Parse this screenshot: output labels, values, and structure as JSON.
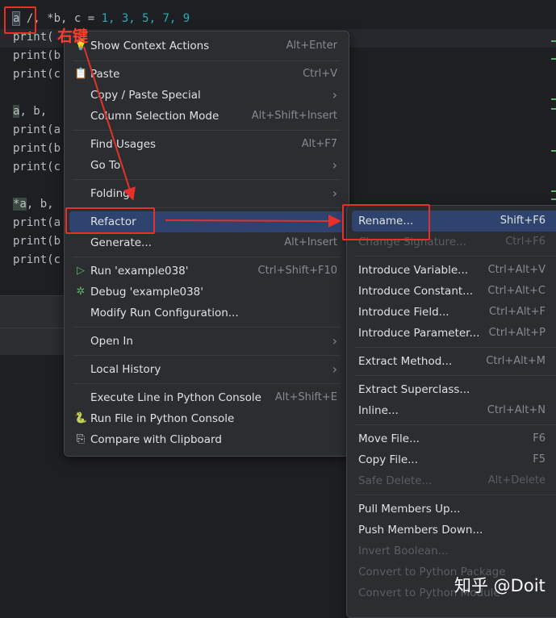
{
  "editor": {
    "lines": [
      {
        "t1": "a",
        "t2": " /, *b, c = ",
        "nums": "1, 3, 5, 7, 9"
      },
      {
        "code": "print("
      },
      {
        "code": "print(b"
      },
      {
        "code": "print(c"
      },
      {
        "code": ""
      },
      {
        "t1": "a",
        "t2": ", b,"
      },
      {
        "code": "print(a"
      },
      {
        "code": "print(b"
      },
      {
        "code": "print(c"
      },
      {
        "code": ""
      },
      {
        "t1": "*a",
        "t2": ", b,"
      },
      {
        "code": "print(a"
      },
      {
        "code": "print(b"
      },
      {
        "code": "print(c"
      }
    ]
  },
  "annotation": {
    "label": "右键"
  },
  "context_menu": {
    "items": [
      {
        "label": "Show Context Actions",
        "shortcut": "Alt+Enter",
        "icon": "lightbulb-icon",
        "glyph": "💡"
      },
      {
        "label": "Paste",
        "shortcut": "Ctrl+V",
        "icon": "clipboard-icon",
        "glyph": "📋"
      },
      {
        "label": "Copy / Paste Special",
        "arrow": "›"
      },
      {
        "label": "Column Selection Mode",
        "shortcut": "Alt+Shift+Insert"
      },
      {
        "label": "Find Usages",
        "shortcut": "Alt+F7"
      },
      {
        "label": "Go To",
        "arrow": "›"
      },
      {
        "label": "Folding",
        "arrow": "›"
      },
      {
        "label": "Refactor",
        "arrow": "›"
      },
      {
        "label": "Generate...",
        "shortcut": "Alt+Insert"
      },
      {
        "label": "Run 'example038'",
        "shortcut": "Ctrl+Shift+F10",
        "icon": "run-icon",
        "glyph": "▷"
      },
      {
        "label": "Debug 'example038'",
        "icon": "debug-icon",
        "glyph": "✲"
      },
      {
        "label": "Modify Run Configuration..."
      },
      {
        "label": "Open In",
        "arrow": "›"
      },
      {
        "label": "Local History",
        "arrow": "›"
      },
      {
        "label": "Execute Line in Python Console",
        "shortcut": "Alt+Shift+E"
      },
      {
        "label": "Run File in Python Console",
        "icon": "python-icon",
        "glyph": "🐍"
      },
      {
        "label": "Compare with Clipboard",
        "icon": "compare-icon",
        "glyph": "⎘"
      }
    ]
  },
  "refactor_menu": {
    "items": [
      {
        "label": "Rename...",
        "shortcut": "Shift+F6"
      },
      {
        "label": "Change Signature...",
        "shortcut": "Ctrl+F6"
      },
      {
        "label": "Introduce Variable...",
        "shortcut": "Ctrl+Alt+V"
      },
      {
        "label": "Introduce Constant...",
        "shortcut": "Ctrl+Alt+C"
      },
      {
        "label": "Introduce Field...",
        "shortcut": "Ctrl+Alt+F"
      },
      {
        "label": "Introduce Parameter...",
        "shortcut": "Ctrl+Alt+P"
      },
      {
        "label": "Extract Method...",
        "shortcut": "Ctrl+Alt+M"
      },
      {
        "label": "Extract Superclass..."
      },
      {
        "label": "Inline...",
        "shortcut": "Ctrl+Alt+N"
      },
      {
        "label": "Move File...",
        "shortcut": "F6"
      },
      {
        "label": "Copy File...",
        "shortcut": "F5"
      },
      {
        "label": "Safe Delete...",
        "shortcut": "Alt+Delete"
      },
      {
        "label": "Pull Members Up..."
      },
      {
        "label": "Push Members Down..."
      },
      {
        "label": "Invert Boolean..."
      },
      {
        "label": "Convert to Python Package"
      },
      {
        "label": "Convert to Python Module"
      }
    ]
  },
  "watermark": {
    "text": "知乎 @Doit"
  }
}
